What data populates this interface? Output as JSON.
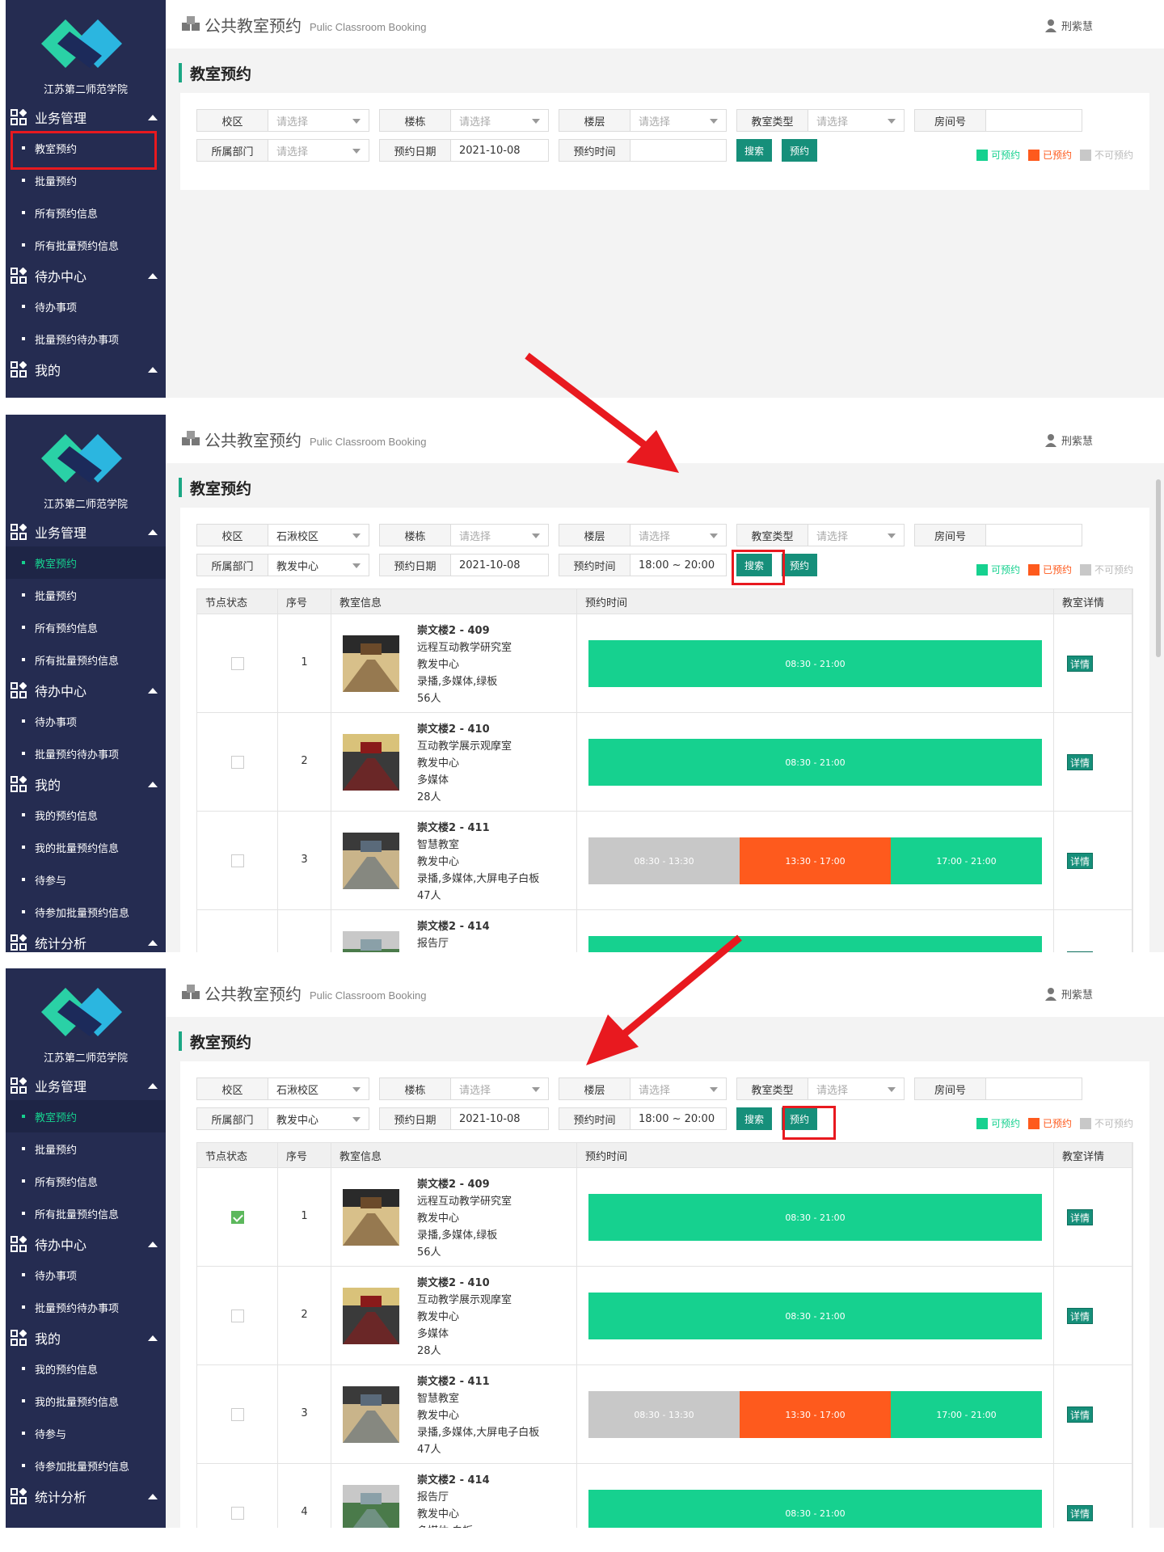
{
  "app": {
    "school_name": "江苏第二师范学院",
    "title": "公共教室预约",
    "subtitle": "Pulic Classroom Booking",
    "user": "刑紫慧",
    "page_title": "教室预约"
  },
  "menu_short": [
    {
      "group": "业务管理",
      "items": [
        "教室预约",
        "批量预约",
        "所有预约信息",
        "所有批量预约信息"
      ]
    },
    {
      "group": "待办中心",
      "items": [
        "待办事项",
        "批量预约待办事项"
      ]
    },
    {
      "group": "我的",
      "items": []
    }
  ],
  "menu_long": [
    {
      "group": "业务管理",
      "items": [
        "教室预约",
        "批量预约",
        "所有预约信息",
        "所有批量预约信息"
      ]
    },
    {
      "group": "待办中心",
      "items": [
        "待办事项",
        "批量预约待办事项"
      ]
    },
    {
      "group": "我的",
      "items": [
        "我的预约信息",
        "我的批量预约信息",
        "待参与",
        "待参加批量预约信息"
      ]
    },
    {
      "group": "统计分析",
      "items": []
    }
  ],
  "filters": {
    "campus_label": "校区",
    "building_label": "楼栋",
    "floor_label": "楼层",
    "type_label": "教室类型",
    "room_label": "房间号",
    "dept_label": "所属部门",
    "date_label": "预约日期",
    "time_label": "预约时间",
    "placeholder": "请选择",
    "date_value": "2021-10-08",
    "campus_value": "石湫校区",
    "dept_value": "教发中心",
    "time_value": "18:00 ~ 20:00",
    "search_btn": "搜索",
    "book_btn": "预约"
  },
  "legend": {
    "available": "可预约",
    "available_color": "#16d18f",
    "booked": "已预约",
    "booked_color": "#fe5a1d",
    "unavailable": "不可预约",
    "unavailable_color": "#c8c8c8"
  },
  "table": {
    "headers": [
      "节点状态",
      "序号",
      "教室信息",
      "预约时间",
      "教室详情"
    ],
    "detail_btn": "详情",
    "rows": [
      {
        "seq": "1",
        "name": "崇文楼2 - 409",
        "desc": "远程互动教学研究室",
        "dept": "教发中心",
        "equip": "录播,多媒体,绿板",
        "cap": "56人",
        "slots": [
          {
            "t": "08:30 - 21:00",
            "s": "available"
          }
        ]
      },
      {
        "seq": "2",
        "name": "崇文楼2 - 410",
        "desc": "互动教学展示观摩室",
        "dept": "教发中心",
        "equip": "多媒体",
        "cap": "28人",
        "slots": [
          {
            "t": "08:30 - 21:00",
            "s": "available"
          }
        ]
      },
      {
        "seq": "3",
        "name": "崇文楼2 - 411",
        "desc": "智慧教室",
        "dept": "教发中心",
        "equip": "录播,多媒体,大屏电子白板",
        "cap": "47人",
        "slots": [
          {
            "t": "08:30 - 13:30",
            "s": "unavailable"
          },
          {
            "t": "13:30 - 17:00",
            "s": "booked"
          },
          {
            "t": "17:00 - 21:00",
            "s": "available"
          }
        ]
      },
      {
        "seq": "4",
        "name": "崇文楼2 - 414",
        "desc": "报告厅",
        "dept": "教发中心",
        "equip": "多媒体,白板",
        "cap": "",
        "slots": [
          {
            "t": "08:30 - 21:00",
            "s": "available"
          }
        ]
      }
    ]
  }
}
